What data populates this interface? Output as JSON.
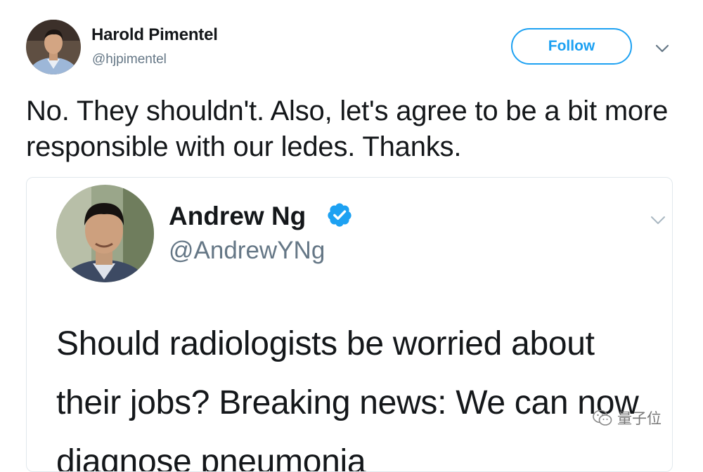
{
  "tweet": {
    "author": {
      "name": "Harold Pimentel",
      "handle": "@hjpimentel"
    },
    "follow_label": "Follow",
    "text": "No. They shouldn't. Also, let's agree to be a bit more responsible with our ledes. Thanks.",
    "quoted": {
      "author": {
        "name": "Andrew Ng",
        "handle": "@AndrewYNg",
        "verified": true
      },
      "text": "Should radiologists be worried about their jobs? Breaking news: We can now diagnose pneumonia"
    }
  },
  "watermark": {
    "text": "量子位",
    "icon": "wechat-icon"
  },
  "colors": {
    "accent": "#1da1f2",
    "secondary_text": "#657786",
    "border": "#e1e8ed"
  }
}
